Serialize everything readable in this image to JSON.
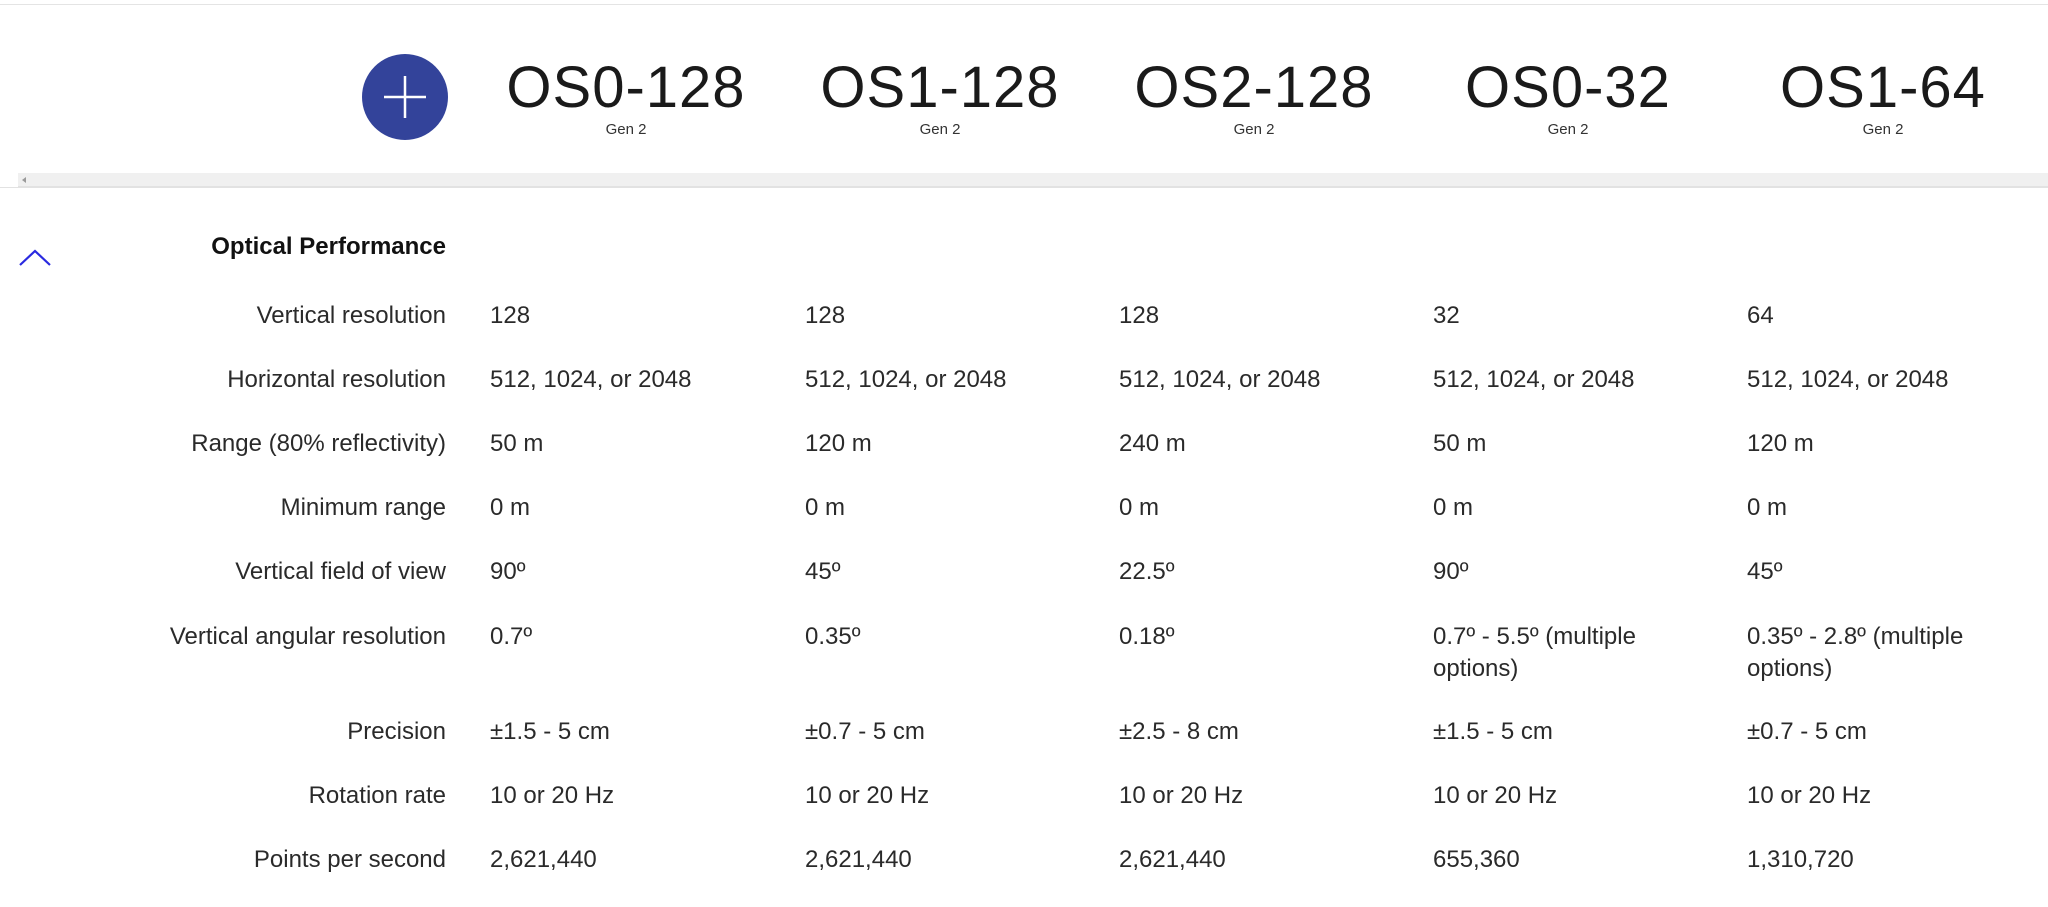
{
  "header": {
    "add_button_label": "Add model",
    "models": [
      {
        "name": "OS0-128",
        "gen": "Gen 2"
      },
      {
        "name": "OS1-128",
        "gen": "Gen 2"
      },
      {
        "name": "OS2-128",
        "gen": "Gen 2"
      },
      {
        "name": "OS0-32",
        "gen": "Gen 2"
      },
      {
        "name": "OS1-64",
        "gen": "Gen 2"
      }
    ]
  },
  "section": {
    "title": "Optical Performance",
    "rows": [
      {
        "label": "Vertical resolution",
        "values": [
          "128",
          "128",
          "128",
          "32",
          "64"
        ]
      },
      {
        "label": "Horizontal resolution",
        "values": [
          "512, 1024, or 2048",
          "512, 1024, or 2048",
          "512, 1024, or 2048",
          "512, 1024, or 2048",
          "512, 1024, or 2048"
        ]
      },
      {
        "label": "Range (80% reflectivity)",
        "values": [
          "50 m",
          "120 m",
          "240 m",
          "50 m",
          "120 m"
        ]
      },
      {
        "label": "Minimum range",
        "values": [
          "0 m",
          "0 m",
          "0 m",
          "0 m",
          "0 m"
        ]
      },
      {
        "label": "Vertical field of view",
        "values": [
          "90º",
          "45º",
          "22.5º",
          "90º",
          "45º"
        ]
      },
      {
        "label": "Vertical angular resolution",
        "values": [
          "0.7º",
          "0.35º",
          "0.18º",
          "0.7º - 5.5º (multiple options)",
          "0.35º - 2.8º (multiple options)"
        ]
      },
      {
        "label": "Precision",
        "values": [
          "±1.5 - 5 cm",
          "±0.7 - 5 cm",
          "±2.5 - 8 cm",
          "±1.5 - 5 cm",
          "±0.7 - 5 cm"
        ]
      },
      {
        "label": "Rotation rate",
        "values": [
          "10 or 20 Hz",
          "10 or 20 Hz",
          "10 or 20 Hz",
          "10 or 20 Hz",
          "10 or 20 Hz"
        ]
      },
      {
        "label": "Points per second",
        "values": [
          "2,621,440",
          "2,621,440",
          "2,621,440",
          "655,360",
          "1,310,720"
        ]
      }
    ]
  },
  "colors": {
    "accent": "#33439a",
    "toggle": "#2a2ae0",
    "text": "#2a2a2a"
  }
}
